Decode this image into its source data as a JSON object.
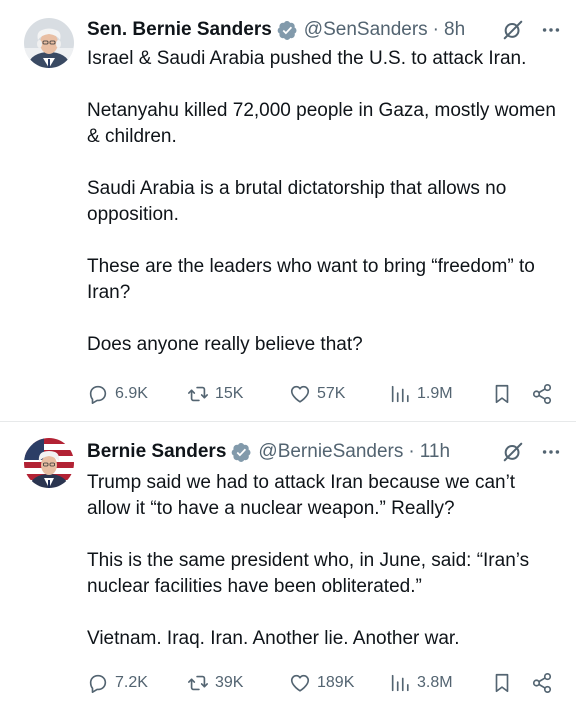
{
  "tweets": [
    {
      "display_name": "Sen. Bernie Sanders",
      "handle": "@SenSanders",
      "separator": "·",
      "time": "8h",
      "paragraphs": [
        "Israel & Saudi Arabia pushed the U.S. to attack Iran.",
        "Netanyahu killed 72,000 people in Gaza, mostly women & children.",
        "Saudi Arabia is a brutal dictatorship that allows no opposition.",
        "These are the leaders who want to bring “freedom” to Iran?",
        "Does anyone really believe that?"
      ],
      "stats": {
        "replies": "6.9K",
        "reposts": "15K",
        "likes": "57K",
        "views": "1.9M"
      }
    },
    {
      "display_name": "Bernie Sanders",
      "handle": "@BernieSanders",
      "separator": "·",
      "time": "11h",
      "paragraphs": [
        "Trump said we had to attack Iran because we can’t allow it “to have a nuclear weapon.” Really?",
        "This is the same president who, in June, said: “Iran’s nuclear facilities have been obliterated.”",
        "Vietnam. Iraq. Iran. Another lie. Another war."
      ],
      "stats": {
        "replies": "7.2K",
        "reposts": "39K",
        "likes": "189K",
        "views": "3.8M"
      }
    }
  ],
  "icons": {
    "verified": "verified-badge-icon",
    "grok": "grok-icon",
    "more": "more-icon",
    "reply": "reply-icon",
    "repost": "repost-icon",
    "like": "heart-icon",
    "views": "views-icon",
    "bookmark": "bookmark-icon",
    "share": "share-icon"
  },
  "colors": {
    "text": "#0f1419",
    "secondary": "#536471",
    "verified": "#829aab",
    "divider": "#e7e9ea"
  }
}
